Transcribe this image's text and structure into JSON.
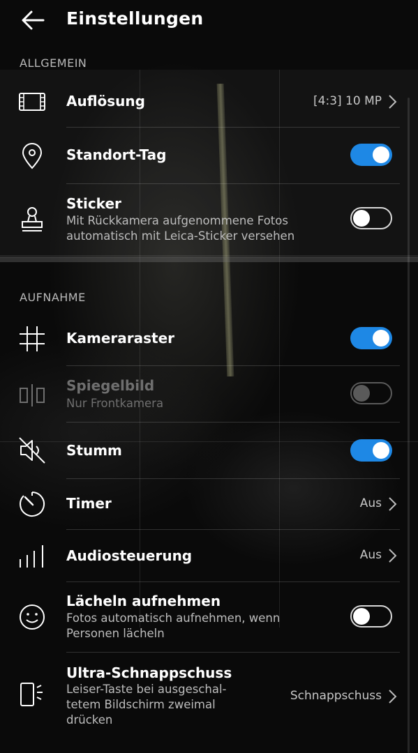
{
  "header": {
    "title": "Einstellungen"
  },
  "sections": {
    "general": "ALLGEMEIN",
    "capture": "AUFNAHME"
  },
  "rows": {
    "resolution": {
      "label": "Auflösung",
      "value": "[4:3] 10 MP",
      "icon": "resolution-icon"
    },
    "location_tag": {
      "label": "Standort-Tag",
      "toggle": "on",
      "icon": "location-pin-icon"
    },
    "sticker": {
      "label": "Sticker",
      "sub": "Mit Rückkamera aufgenommene Fotos\nautomatisch mit Leica-Sticker versehen",
      "toggle": "off",
      "icon": "stamp-icon"
    },
    "camera_grid": {
      "label": "Kameraraster",
      "toggle": "on",
      "icon": "grid-icon"
    },
    "mirror": {
      "label": "Spiegelbild",
      "sub": "Nur Frontkamera",
      "toggle": "disabled",
      "icon": "mirror-icon"
    },
    "mute": {
      "label": "Stumm",
      "toggle": "on",
      "icon": "speaker-muted-icon"
    },
    "timer": {
      "label": "Timer",
      "value": "Aus",
      "icon": "timer-icon"
    },
    "audio_control": {
      "label": "Audiosteuerung",
      "value": "Aus",
      "icon": "audio-bars-icon"
    },
    "smile_capture": {
      "label": "Lächeln aufnehmen",
      "sub": "Fotos automatisch aufnehmen, wenn\nPersonen lächeln",
      "toggle": "off",
      "icon": "smiley-icon"
    },
    "ultra_snapshot": {
      "label": "Ultra-Schnappschuss",
      "sub": "Leiser-Taste bei ausgeschal-\ntetem Bildschirm zweimal\ndrücken",
      "value": "Schnappschuss",
      "icon": "phone-flash-icon"
    }
  },
  "colors": {
    "accent": "#1e88e5",
    "background": "#050505"
  }
}
